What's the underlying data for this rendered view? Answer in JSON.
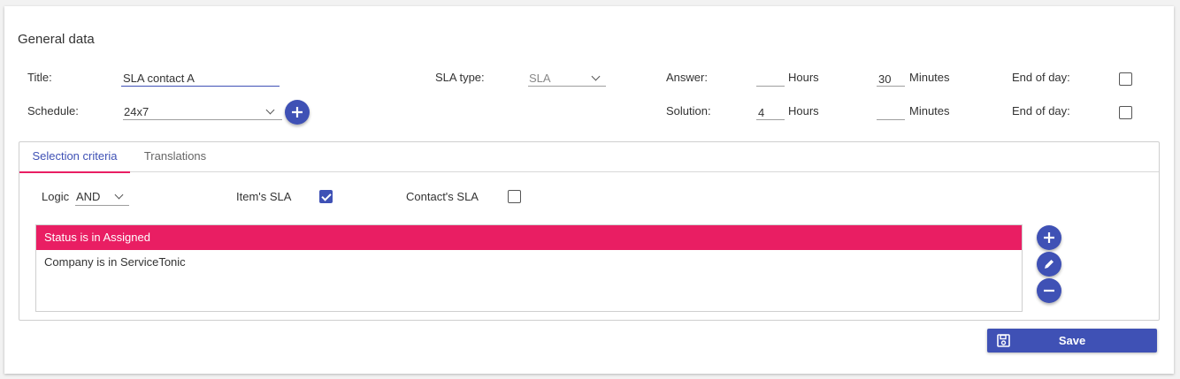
{
  "section_title": "General data",
  "title_field": {
    "label": "Title:",
    "value": "SLA contact A"
  },
  "schedule_field": {
    "label": "Schedule:",
    "value": "24x7"
  },
  "sla_type_field": {
    "label": "SLA type:",
    "value": "SLA"
  },
  "answer": {
    "label": "Answer:",
    "hours_value": "",
    "hours_label": "Hours",
    "minutes_value": "30",
    "minutes_label": "Minutes",
    "eod_label": "End of day:",
    "eod_checked": false
  },
  "solution": {
    "label": "Solution:",
    "hours_value": "4",
    "hours_label": "Hours",
    "minutes_value": "",
    "minutes_label": "Minutes",
    "eod_label": "End of day:",
    "eod_checked": false
  },
  "tabs": [
    {
      "label": "Selection criteria",
      "active": true
    },
    {
      "label": "Translations",
      "active": false
    }
  ],
  "criteria": {
    "logic_label": "Logic",
    "logic_value": "AND",
    "items_sla_label": "Item's SLA",
    "items_sla_checked": true,
    "contacts_sla_label": "Contact's SLA",
    "contacts_sla_checked": false,
    "rows": [
      "Status is in Assigned",
      "Company is in ServiceTonic"
    ]
  },
  "save_label": "Save",
  "colors": {
    "primary": "#3f51b5",
    "accent": "#e91e63"
  }
}
